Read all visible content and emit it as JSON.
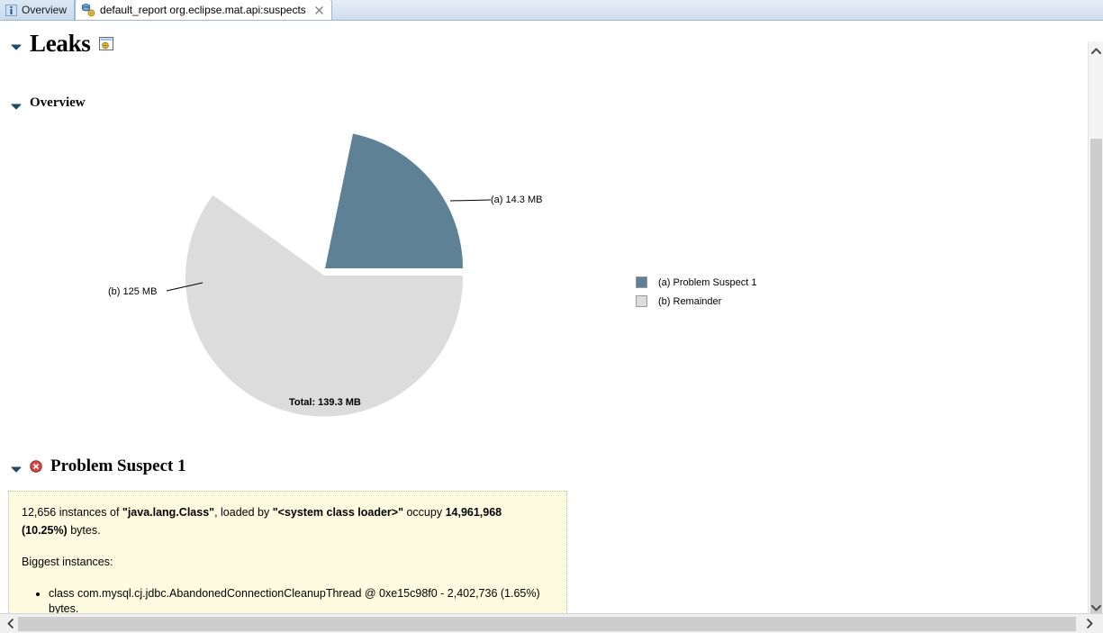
{
  "window": {
    "tabs": [
      {
        "id": "overview",
        "label": "Overview",
        "icon": "info-icon",
        "active": false,
        "closable": false
      },
      {
        "id": "default_report",
        "label": "default_report  org.eclipse.mat.api:suspects",
        "icon": "report-icon",
        "active": true,
        "closable": true
      }
    ]
  },
  "report": {
    "heading": "Leaks",
    "heading_icon": "report-window-icon",
    "overview_heading": "Overview",
    "suspect_heading": "Problem Suspect 1",
    "suspect_icon": "error-icon"
  },
  "chart_data": {
    "type": "pie",
    "title": "",
    "total_label": "Total: 139.3 MB",
    "total_mb": 139.3,
    "legend_position": "right",
    "slices": [
      {
        "key": "(a)",
        "name": "Problem Suspect 1",
        "label": "(a)  14.3 MB",
        "value_mb": 14.3,
        "percent": 10.25,
        "color": "#5e8196",
        "exploded": true
      },
      {
        "key": "(b)",
        "name": "Remainder",
        "label": "(b)  125 MB",
        "value_mb": 125.0,
        "percent": 89.75,
        "color": "#dcdcdc",
        "exploded": false
      }
    ],
    "legend": [
      {
        "swatch": "#5e8196",
        "text": "(a)  Problem Suspect 1"
      },
      {
        "swatch": "#dcdcdc",
        "text": "(b)  Remainder"
      }
    ],
    "labels": [
      {
        "text": "(a)  14.3 MB",
        "anchor": "right"
      },
      {
        "text": "(b)  125 MB",
        "anchor": "left"
      }
    ]
  },
  "suspect": {
    "line1_pre": "12,656 instances of ",
    "line1_class": "\"java.lang.Class\"",
    "line1_mid": ", loaded by ",
    "line1_loader": "\"<system class loader>\"",
    "line1_post": " occupy ",
    "line1_bytes": "14,961,968 (10.25%)",
    "line1_end": " bytes.",
    "biggest_label": "Biggest instances:",
    "instances": [
      "class com.mysql.cj.jdbc.AbandonedConnectionCleanupThread @ 0xe15c98f0 - 2,402,736 (1.65%) bytes."
    ]
  },
  "colors": {
    "accent_blue": "#5e8196",
    "remainder_gray": "#dcdcdc",
    "suspect_box_bg": "#fdfce1",
    "tab_active_bg": "#ffffff"
  }
}
